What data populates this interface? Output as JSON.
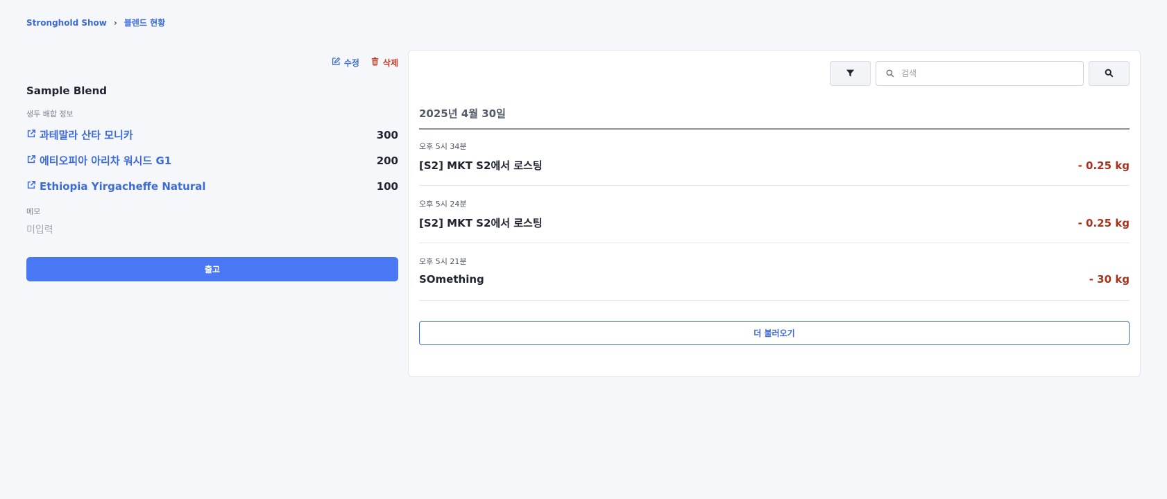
{
  "breadcrumb": {
    "root": "Stronghold Show",
    "separator": "›",
    "current": "블렌드 현황"
  },
  "blend": {
    "edit_label": "수정",
    "delete_label": "삭제",
    "title": "Sample Blend",
    "composition_label": "생두 배합 정보",
    "beans": [
      {
        "name": "과테말라 산타 모니카",
        "qty": "300"
      },
      {
        "name": "에티오피아 아리차 워시드 G1",
        "qty": "200"
      },
      {
        "name": "Ethiopia Yirgacheffe Natural",
        "qty": "100"
      }
    ],
    "memo_label": "메모",
    "memo_value": "미입력",
    "ship_label": "출고"
  },
  "history": {
    "search_placeholder": "검색",
    "date_header": "2025년 4월 30일",
    "entries": [
      {
        "time": "오후 5시 34분",
        "title": "[S2] MKT S2에서 로스팅",
        "amount": "- 0.25 kg"
      },
      {
        "time": "오후 5시 24분",
        "title": "[S2] MKT S2에서 로스팅",
        "amount": "- 0.25 kg"
      },
      {
        "time": "오후 5시 21분",
        "title": "SOmething",
        "amount": "- 30 kg"
      }
    ],
    "load_more_label": "더 불러오기"
  },
  "colors": {
    "accent": "#3d6bd6",
    "primary_button": "#4a78f5",
    "danger": "#c23a24",
    "negative_amount": "#a8321c"
  },
  "icons": {
    "edit": "edit-icon",
    "delete": "trash-icon",
    "bean_link": "external-link-icon",
    "filter": "filter-icon",
    "search": "search-icon"
  }
}
